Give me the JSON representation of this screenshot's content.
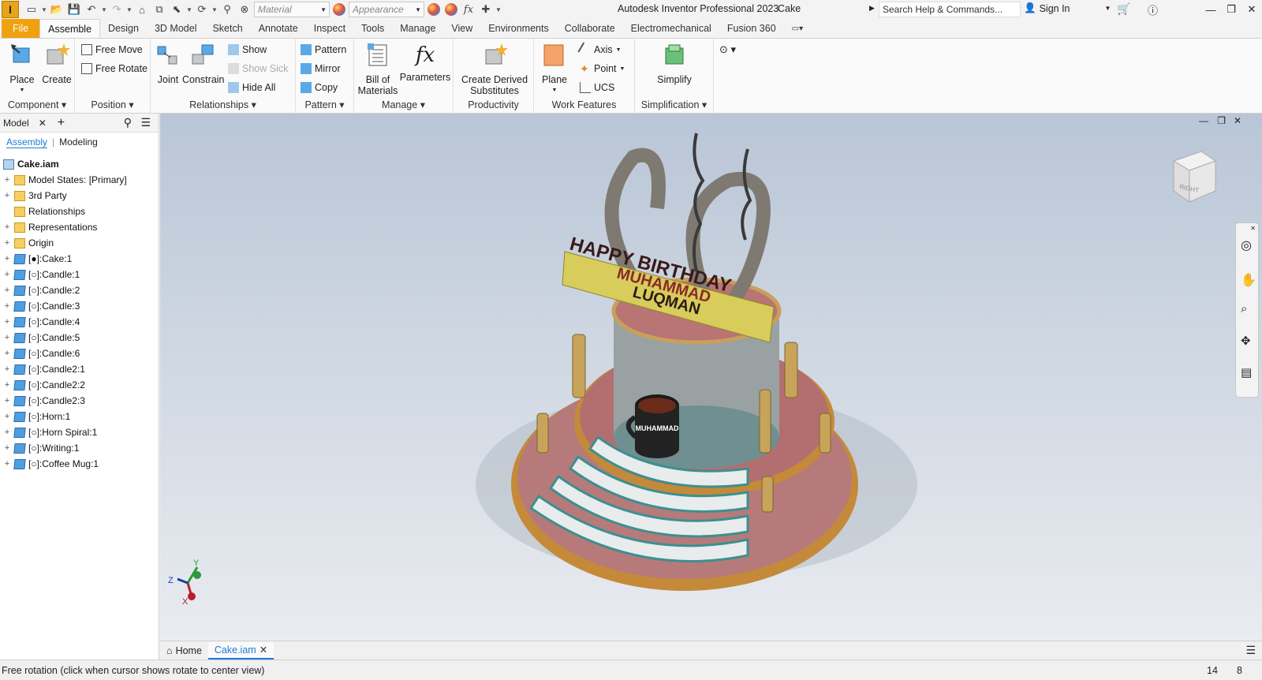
{
  "app": {
    "logo": "I",
    "title": "Autodesk Inventor Professional 2023",
    "document": "Cake"
  },
  "toolbar": {
    "material_placeholder": "Material",
    "appearance_placeholder": "Appearance",
    "fx": "fx"
  },
  "help": {
    "search_placeholder": "Search Help & Commands...",
    "sign_in": "Sign In"
  },
  "tabs": [
    "File",
    "Assemble",
    "Design",
    "3D Model",
    "Sketch",
    "Annotate",
    "Inspect",
    "Tools",
    "Manage",
    "View",
    "Environments",
    "Collaborate",
    "Electromechanical",
    "Fusion 360"
  ],
  "active_tab": "Assemble",
  "ribbon": {
    "component": {
      "title": "Component",
      "place": "Place",
      "create": "Create"
    },
    "position": {
      "title": "Position",
      "free_move": "Free Move",
      "free_rotate": "Free Rotate"
    },
    "relationships": {
      "title": "Relationships",
      "joint": "Joint",
      "constrain": "Constrain",
      "show": "Show",
      "show_sick": "Show Sick",
      "hide_all": "Hide All"
    },
    "pattern": {
      "title": "Pattern",
      "pattern": "Pattern",
      "mirror": "Mirror",
      "copy": "Copy"
    },
    "manage": {
      "title": "Manage",
      "bom_line1": "Bill of",
      "bom_line2": "Materials",
      "parameters": "Parameters"
    },
    "productivity": {
      "title": "Productivity",
      "cds_line1": "Create Derived",
      "cds_line2": "Substitutes"
    },
    "work_features": {
      "title": "Work Features",
      "plane": "Plane",
      "axis": "Axis",
      "point": "Point",
      "ucs": "UCS"
    },
    "simplification": {
      "title": "Simplification",
      "simplify": "Simplify"
    }
  },
  "browser": {
    "tab": "Model",
    "subtabs": [
      "Assembly",
      "Modeling"
    ],
    "root": "Cake.iam",
    "items": [
      {
        "label": "Model States: [Primary]",
        "icon": "folder",
        "exp": "+"
      },
      {
        "label": "3rd Party",
        "icon": "folder",
        "exp": "+"
      },
      {
        "label": "Relationships",
        "icon": "folder",
        "exp": ""
      },
      {
        "label": "Representations",
        "icon": "folder",
        "exp": "+"
      },
      {
        "label": "Origin",
        "icon": "folder",
        "exp": "+"
      },
      {
        "label": "[●]:Cake:1",
        "icon": "part",
        "exp": "+"
      },
      {
        "label": "[○]:Candle:1",
        "icon": "part",
        "exp": "+"
      },
      {
        "label": "[○]:Candle:2",
        "icon": "part",
        "exp": "+"
      },
      {
        "label": "[○]:Candle:3",
        "icon": "part",
        "exp": "+"
      },
      {
        "label": "[○]:Candle:4",
        "icon": "part",
        "exp": "+"
      },
      {
        "label": "[○]:Candle:5",
        "icon": "part",
        "exp": "+"
      },
      {
        "label": "[○]:Candle:6",
        "icon": "part",
        "exp": "+"
      },
      {
        "label": "[○]:Candle2:1",
        "icon": "part",
        "exp": "+"
      },
      {
        "label": "[○]:Candle2:2",
        "icon": "part",
        "exp": "+"
      },
      {
        "label": "[○]:Candle2:3",
        "icon": "part",
        "exp": "+"
      },
      {
        "label": "[○]:Horn:1",
        "icon": "part",
        "exp": "+"
      },
      {
        "label": "[○]:Horn Spiral:1",
        "icon": "part",
        "exp": "+"
      },
      {
        "label": "[○]:Writing:1",
        "icon": "part",
        "exp": "+"
      },
      {
        "label": "[○]:Coffee Mug:1",
        "icon": "part",
        "exp": "+"
      }
    ]
  },
  "model": {
    "banner_line1": "HAPPY BIRTHDAY",
    "banner_line2": "MUHAMMAD",
    "banner_line3": "LUQMAN",
    "mug_text": "MUHAMMAD",
    "viewcube_face": "RIGHT"
  },
  "triad": {
    "x": "X",
    "y": "Y",
    "z": "Z"
  },
  "doctabs": {
    "home": "Home",
    "active": "Cake.iam"
  },
  "status": {
    "message": "Free rotation (click when cursor shows rotate to center view)",
    "count1": "14",
    "count2": "8"
  }
}
